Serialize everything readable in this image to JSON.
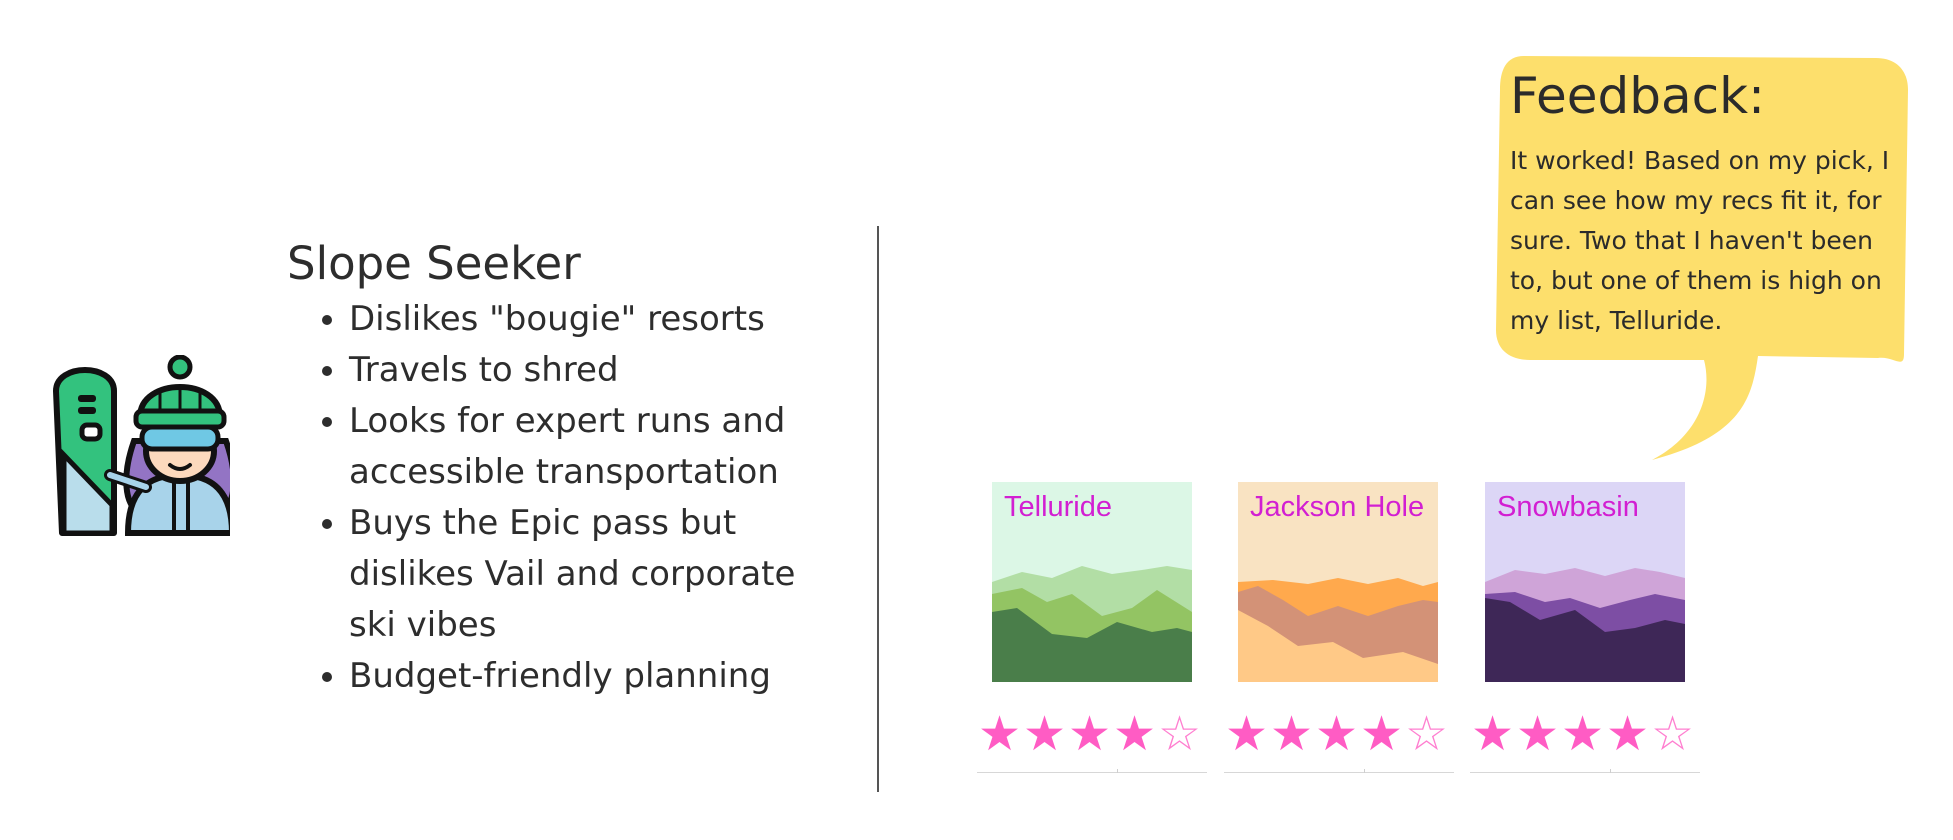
{
  "persona": {
    "title": "Slope Seeker",
    "traits": [
      "Dislikes  \"bougie\" resorts",
      "Travels to shred",
      "Looks for expert runs and accessible transportation",
      "Buys the Epic pass but dislikes Vail and corporate ski vibes",
      "Budget-friendly planning"
    ]
  },
  "feedback": {
    "title": "Feedback:",
    "text": "It worked! Based on my pick, I can see how my recs fit it, for sure. Two that I haven't been to, but one of them is high on my list, Telluride."
  },
  "resorts": [
    {
      "name": "Telluride",
      "rating": 4,
      "max": 5
    },
    {
      "name": "Jackson Hole",
      "rating": 4,
      "max": 5
    },
    {
      "name": "Snowbasin",
      "rating": 4,
      "max": 5
    }
  ],
  "colors": {
    "bubble": "#fddf6c",
    "star": "#ff5cc4",
    "resort_label": "#d21fd2",
    "telluride": [
      "#dcf7e6",
      "#b2dea5",
      "#93c463",
      "#4a7e4a"
    ],
    "jackson_hole": [
      "#f9e3c2",
      "#ffa94d",
      "#d39277",
      "#ffc987"
    ],
    "snowbasin": [
      "#dcd6f6",
      "#cfa4d8",
      "#7d4ea4",
      "#3e2757"
    ]
  },
  "icons": {
    "avatar": "snowboarder-icon",
    "star_full": "star-filled-icon",
    "star_empty": "star-outline-icon"
  }
}
